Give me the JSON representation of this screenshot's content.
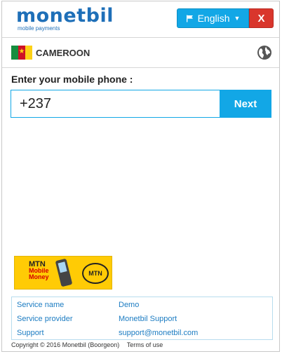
{
  "brand": {
    "logo_text": "monetbil",
    "tagline": "mobile payments"
  },
  "header": {
    "language_label": "English",
    "close_label": "X",
    "colors": {
      "primary": "#12a7e6",
      "close": "#d9362c",
      "brand": "#1e6fb8"
    }
  },
  "country": {
    "name": "CAMEROON",
    "flag_icon": "cameroon-flag-icon",
    "change_icon": "globe-icon"
  },
  "phone": {
    "label": "Enter your mobile phone :",
    "value": "+237",
    "submit_label": "Next"
  },
  "operator": {
    "logo_lines": [
      "MTN",
      "Mobile",
      "Money"
    ],
    "badge_text": "MTN"
  },
  "info": {
    "rows": [
      {
        "key": "Service name",
        "value": "Demo"
      },
      {
        "key": "Service provider",
        "value": "Monetbil Support"
      },
      {
        "key": "Support",
        "value": "support@monetbil.com"
      }
    ]
  },
  "footer": {
    "copyright": "Copyright © 2016 Monetbil (Boorgeon)",
    "terms_label": "Terms of use"
  }
}
